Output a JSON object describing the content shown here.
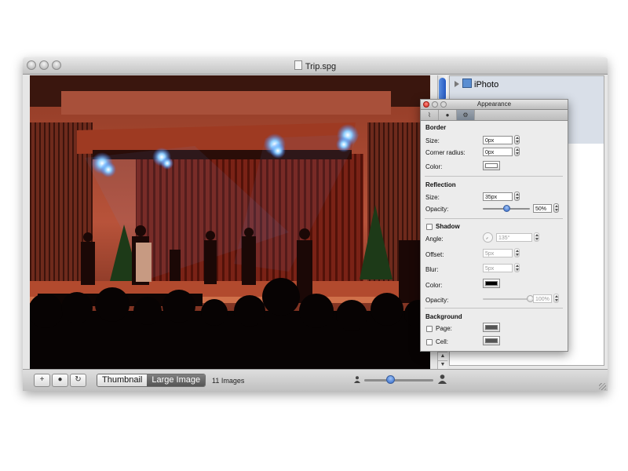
{
  "window": {
    "title": "Trip.spg"
  },
  "sidebar": {
    "items": [
      {
        "label": "iPhoto"
      }
    ]
  },
  "bottom_bar": {
    "view_modes": [
      {
        "label": "Thumbnail",
        "active": false
      },
      {
        "label": "Large Image",
        "active": true
      }
    ],
    "image_count": "11 Images",
    "zoom_level": 0.38
  },
  "appearance_panel": {
    "title": "Appearance",
    "tabs": [
      "paperclip-icon",
      "person-icon",
      "gear-icon"
    ],
    "active_tab": 2,
    "border": {
      "heading": "Border",
      "size_label": "Size:",
      "size_value": "0px",
      "radius_label": "Corner radius:",
      "radius_value": "0px",
      "color_label": "Color:",
      "color": "#ffffff"
    },
    "reflection": {
      "heading": "Reflection",
      "size_label": "Size:",
      "size_value": "35px",
      "opacity_label": "Opacity:",
      "opacity_value": "50%",
      "opacity_fraction": 0.5
    },
    "shadow": {
      "heading": "Shadow",
      "enabled": false,
      "angle_label": "Angle:",
      "angle_value": "135°",
      "offset_label": "Offset:",
      "offset_value": "5px",
      "blur_label": "Blur:",
      "blur_value": "5px",
      "color_label": "Color:",
      "color": "#000000",
      "opacity_label": "Opacity:",
      "opacity_value": "100%",
      "opacity_fraction": 1.0
    },
    "background": {
      "heading": "Background",
      "page_label": "Page:",
      "page_checked": false,
      "page_color": "#555555",
      "cell_label": "Cell:",
      "cell_checked": false,
      "cell_color": "#555555"
    }
  },
  "colors": {
    "accent": "#2b63c8",
    "stage_light": "#b84a32"
  }
}
